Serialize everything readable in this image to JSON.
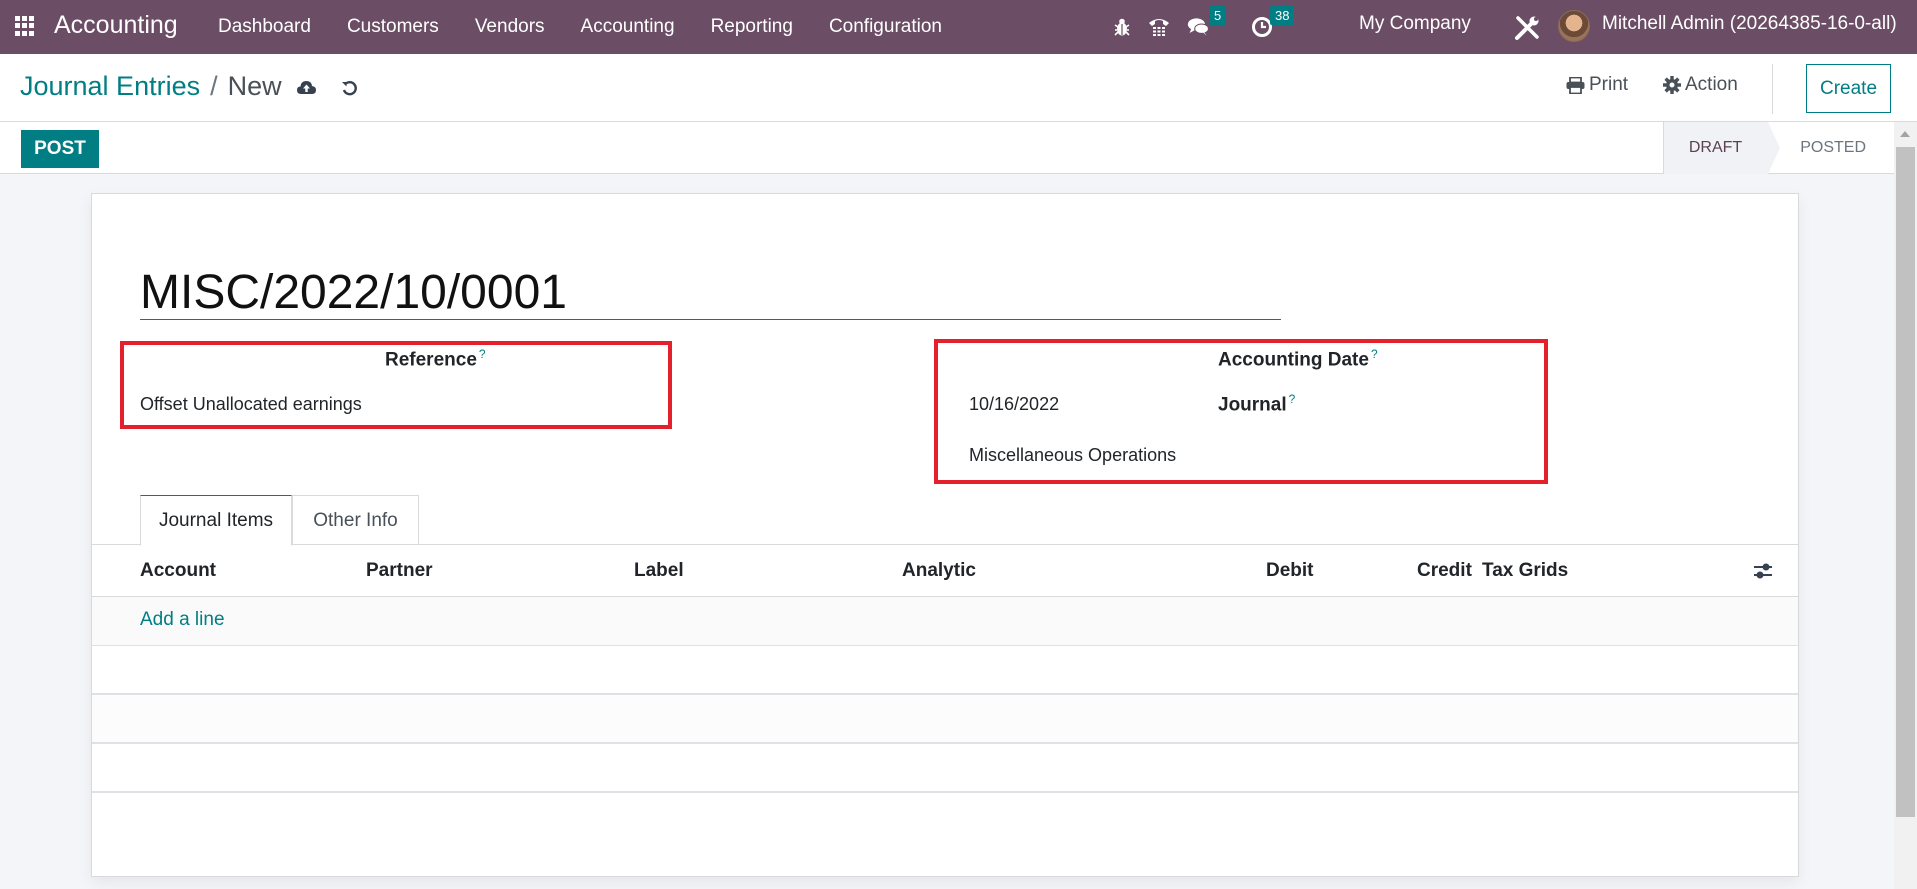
{
  "navbar": {
    "app_name": "Accounting",
    "menu": [
      "Dashboard",
      "Customers",
      "Vendors",
      "Accounting",
      "Reporting",
      "Configuration"
    ],
    "messages_count": "5",
    "activities_count": "38",
    "company": "My Company",
    "user": "Mitchell Admin (20264385-16-0-all)"
  },
  "control_panel": {
    "breadcrumb_parent": "Journal Entries",
    "breadcrumb_separator": "/",
    "breadcrumb_current": "New",
    "print_label": "Print",
    "action_label": "Action",
    "create_label": "Create"
  },
  "statusbar": {
    "post_label": "POST",
    "steps": [
      "DRAFT",
      "POSTED"
    ],
    "current_step": "DRAFT"
  },
  "form": {
    "record_name": "MISC/2022/10/0001",
    "reference_label": "Reference",
    "reference_value": "Offset Unallocated earnings",
    "accounting_date_label": "Accounting Date",
    "accounting_date_value": "10/16/2022",
    "journal_label": "Journal",
    "journal_value": "Miscellaneous Operations",
    "help_marker": "?"
  },
  "tabs": [
    "Journal Items",
    "Other Info"
  ],
  "table": {
    "columns": [
      "Account",
      "Partner",
      "Label",
      "Analytic",
      "Debit",
      "Credit",
      "Tax Grids"
    ],
    "add_line_label": "Add a line",
    "rows": []
  },
  "colors": {
    "navbar": "#6b4d65",
    "primary": "#017e84",
    "highlight": "#e3202c"
  }
}
